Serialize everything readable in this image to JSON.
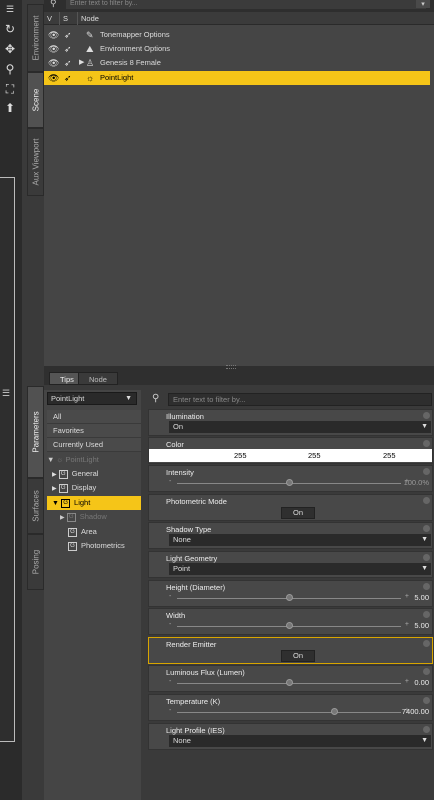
{
  "scene": {
    "filter_placeholder": "Enter text to filter by...",
    "columns": {
      "v": "V",
      "s": "S",
      "node": "Node"
    },
    "rows": [
      {
        "label": "Tonemapper Options",
        "selected": false
      },
      {
        "label": "Environment Options",
        "selected": false
      },
      {
        "label": "Genesis 8 Female",
        "selected": false,
        "expandable": true
      },
      {
        "label": "PointLight",
        "selected": true
      }
    ]
  },
  "vertical_tabs": {
    "environment": "Environment",
    "scene": "Scene",
    "aux_viewport": "Aux Viewport",
    "parameters": "Parameters",
    "surfaces": "Surfaces",
    "posing": "Posing"
  },
  "bottom_tabs": {
    "tips": "Tips",
    "node": "Node"
  },
  "params": {
    "node_dropdown": "PointLight",
    "categories": [
      "All",
      "Favorites",
      "Currently Used"
    ],
    "tree": {
      "root": "PointLight",
      "general": "General",
      "display": "Display",
      "light": "Light",
      "shadow": "Shadow",
      "area": "Area",
      "photometrics": "Photometrics"
    },
    "filter_placeholder": "Enter text to filter by...",
    "properties": {
      "illumination": {
        "label": "Illumination",
        "value": "On"
      },
      "color": {
        "label": "Color",
        "r": "255",
        "g": "255",
        "b": "255"
      },
      "intensity": {
        "label": "Intensity",
        "value": "100.0%",
        "level": 0.5
      },
      "photometric_mode": {
        "label": "Photometric Mode",
        "button": "On"
      },
      "shadow_type": {
        "label": "Shadow Type",
        "value": "None"
      },
      "light_geometry": {
        "label": "Light Geometry",
        "value": "Point"
      },
      "height": {
        "label": "Height (Diameter)",
        "value": "5.00",
        "level": 0.5
      },
      "width": {
        "label": "Width",
        "value": "5.00",
        "level": 0.5
      },
      "render_emitter": {
        "label": "Render Emitter",
        "button": "On"
      },
      "luminous_flux": {
        "label": "Luminous Flux (Lumen)",
        "value": "0.00",
        "level": 0.5
      },
      "temperature": {
        "label": "Temperature (K)",
        "value": "7400.00",
        "level": 0.71
      },
      "light_profile": {
        "label": "Light Profile (IES)",
        "value": "None"
      }
    }
  },
  "colors": {
    "accent": "#f5c518",
    "panel": "#3a3a3a"
  }
}
